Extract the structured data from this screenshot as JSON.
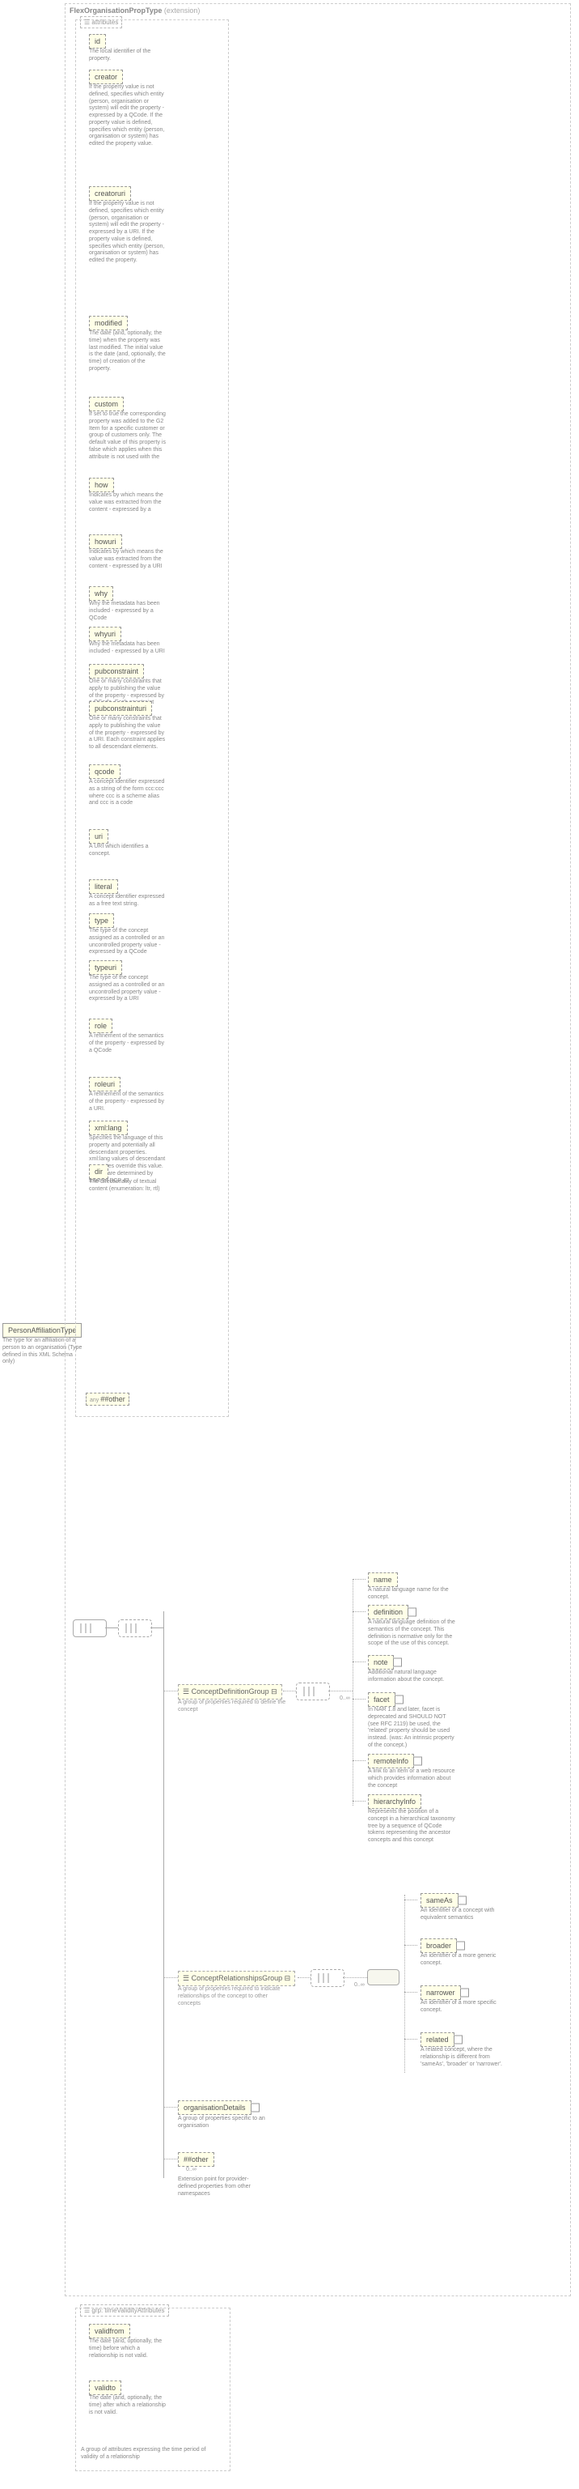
{
  "root": {
    "name": "PersonAffiliationType",
    "desc": "The type for an affiliation of a person to an organisation (Type defined in this XML Schema only)"
  },
  "extHeader": {
    "type": "FlexOrganisationPropType",
    "ext": "(extension)"
  },
  "attrsLabel": "attributes",
  "attrs": [
    {
      "name": "id",
      "desc": "The local identifier of the property."
    },
    {
      "name": "creator",
      "desc": "If the property value is not defined, specifies which entity (person, organisation or system) will edit the property - expressed by a QCode. If the property value is defined, specifies which entity (person, organisation or system) has edited the property value."
    },
    {
      "name": "creatoruri",
      "desc": "If the property value is not defined, specifies which entity (person, organisation or system) will edit the property - expressed by a URI. If the property value is defined, specifies which entity (person, organisation or system) has edited the property."
    },
    {
      "name": "modified",
      "desc": "The date (and, optionally, the time) when the property was last modified. The initial value is the date (and, optionally, the time) of creation of the property."
    },
    {
      "name": "custom",
      "desc": "If set to true the corresponding property was added to the G2 Item for a specific customer or group of customers only. The default value of this property is false which applies when this attribute is not used with the"
    },
    {
      "name": "how",
      "desc": "Indicates by which means the value was extracted from the content - expressed by a"
    },
    {
      "name": "howuri",
      "desc": "Indicates by which means the value was extracted from the content - expressed by a URI"
    },
    {
      "name": "why",
      "desc": "Why the metadata has been included - expressed by a QCode"
    },
    {
      "name": "whyuri",
      "desc": "Why the metadata has been included - expressed by a URI"
    },
    {
      "name": "pubconstraint",
      "desc": "One or many constraints that apply to publishing the value of the property - expressed by a QCode. Each constraint applies to all descendant"
    },
    {
      "name": "pubconstrainturi",
      "desc": "One or many constraints that apply to publishing the value of the property - expressed by a URI. Each constraint applies to all descendant elements."
    },
    {
      "name": "qcode",
      "desc": "A concept identifier expressed as a string of the form ccc:ccc where ccc is a scheme alias and ccc is a code"
    },
    {
      "name": "uri",
      "desc": "A URI which identifies a concept."
    },
    {
      "name": "literal",
      "desc": "A concept identifier expressed as a free text string."
    },
    {
      "name": "type",
      "desc": "The type of the concept assigned as a controlled or an uncontrolled property value - expressed by a QCode"
    },
    {
      "name": "typeuri",
      "desc": "The type of the concept assigned as a controlled or an uncontrolled property value - expressed by a URI"
    },
    {
      "name": "role",
      "desc": "A refinement of the semantics of the property - expressed by a QCode"
    },
    {
      "name": "roleuri",
      "desc": "A refinement of the semantics of the property - expressed by a URI."
    },
    {
      "name": "xml:lang",
      "desc": "Specifies the language of this property and potentially all descendant properties. xml:lang values of descendant properties override this value. Values are determined by Internet BCP 47."
    },
    {
      "name": "dir",
      "desc": "The directionality of textual content (enumeration: ltr, rtl)"
    }
  ],
  "otherAny": "##other",
  "conceptDef": {
    "name": "ConceptDefinitionGroup",
    "desc": "A group of properties required to define the concept"
  },
  "conceptDefItems": [
    {
      "name": "name",
      "plus": false,
      "desc": "A natural language name for the concept."
    },
    {
      "name": "definition",
      "plus": true,
      "desc": "A natural language definition of the semantics of the concept. This definition is normative only for the scope of the use of this concept."
    },
    {
      "name": "note",
      "plus": true,
      "desc": "Additional natural language information about the concept."
    },
    {
      "name": "facet",
      "plus": true,
      "desc": "In NAR 1.8 and later, facet is deprecated and SHOULD NOT (see RFC 2119) be used, the 'related' property should be used instead. (was: An intrinsic property of the concept.)"
    },
    {
      "name": "remoteInfo",
      "plus": true,
      "desc": "A link to an item or a web resource which provides information about the concept"
    },
    {
      "name": "hierarchyInfo",
      "plus": false,
      "desc": "Represents the position of a concept in a hierarchical taxonomy tree by a sequence of QCode tokens representing the ancestor concepts and this concept"
    }
  ],
  "conceptRel": {
    "name": "ConceptRelationshipsGroup",
    "desc": "A group of properties required to indicate relationships of the concept to other concepts"
  },
  "conceptRelItems": [
    {
      "name": "sameAs",
      "desc": "An identifier of a concept with equivalent semantics"
    },
    {
      "name": "broader",
      "desc": "An identifier of a more generic concept."
    },
    {
      "name": "narrower",
      "desc": "An identifier of a more specific concept."
    },
    {
      "name": "related",
      "desc": "A related concept, where the relationship is different from 'sameAs', 'broader' or 'narrower'."
    }
  ],
  "orgDetails": {
    "name": "organisationDetails",
    "desc": "A group of properties specific to an organisation"
  },
  "otherBlock": {
    "name": "##other",
    "desc": "Extension point for provider-defined properties from other namespaces"
  },
  "cardinality": "0..∞",
  "timeValidity": {
    "label": "timeValidityAttributes",
    "attrs": [
      {
        "name": "validfrom",
        "desc": "The date (and, optionally, the time) before which a relationship is not valid."
      },
      {
        "name": "validto",
        "desc": "The date (and, optionally, the time) after which a relationship is not valid."
      }
    ],
    "groupDesc": "A group of attributes expressing the time period of validity of a relationship"
  }
}
